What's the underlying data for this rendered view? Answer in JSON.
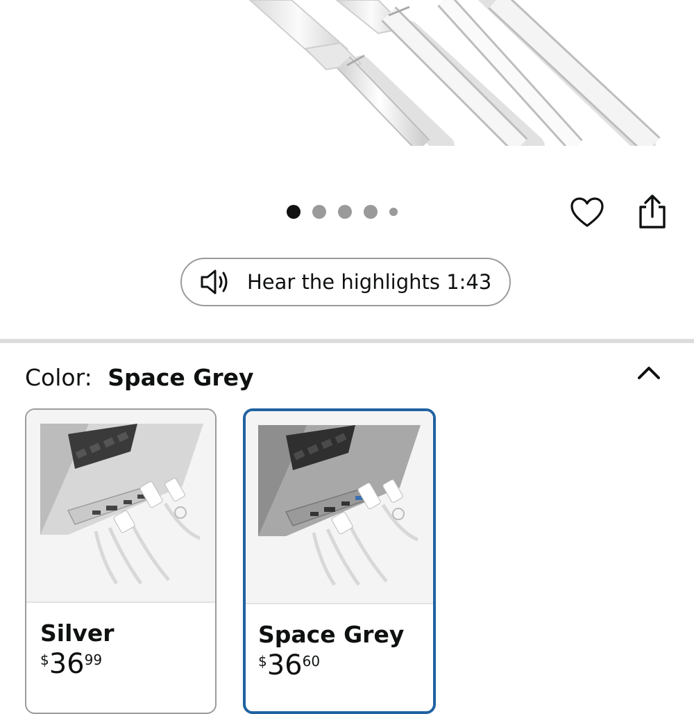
{
  "carousel": {
    "total_slides": 5,
    "active_index": 0
  },
  "actions": {
    "favorite_icon": "heart-icon",
    "share_icon": "share-icon"
  },
  "audio": {
    "label": "Hear the highlights 1:43",
    "icon": "speaker-icon"
  },
  "color": {
    "key_label": "Color:",
    "selected_value": "Space Grey",
    "collapse_icon": "chevron-up-icon"
  },
  "variants": [
    {
      "name": "Silver",
      "price_symbol": "$",
      "price_whole": "36",
      "price_fraction": "99",
      "selected": false
    },
    {
      "name": "Space Grey",
      "price_symbol": "$",
      "price_whole": "36",
      "price_fraction": "60",
      "selected": true
    }
  ],
  "colors": {
    "selected_border": "#2162a1",
    "divider": "#dcdcdc",
    "text": "#0f1111"
  }
}
